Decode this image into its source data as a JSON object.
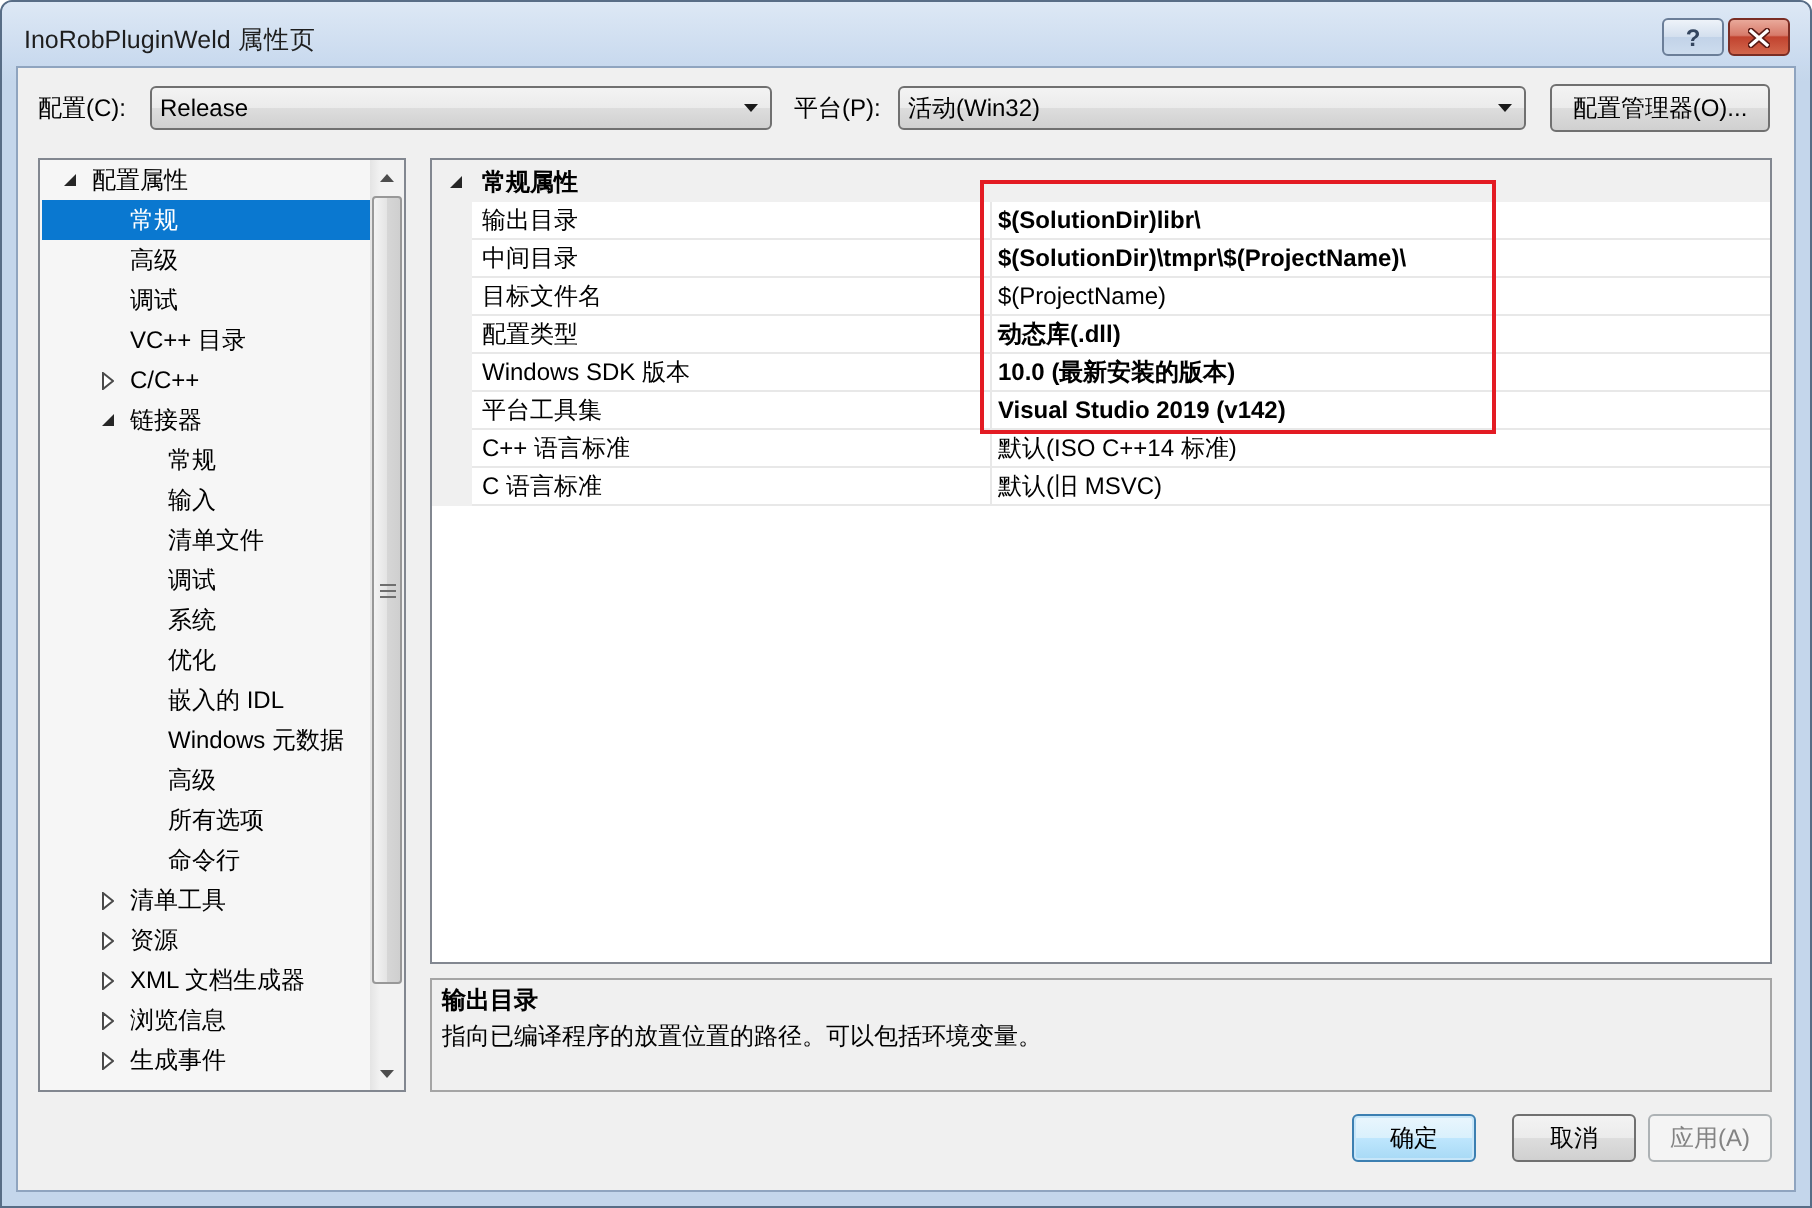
{
  "window": {
    "title": "InoRobPluginWeld 属性页",
    "help_button": "?"
  },
  "toolbar": {
    "configuration": {
      "label": "配置(C):",
      "value": "Release"
    },
    "platform": {
      "label": "平台(P):",
      "value": "活动(Win32)"
    },
    "manager_button": "配置管理器(O)..."
  },
  "tree": {
    "items": [
      {
        "label": "配置属性",
        "expanded": true,
        "selected": false,
        "children": [
          {
            "label": "常规",
            "selected": true
          },
          {
            "label": "高级",
            "selected": false
          },
          {
            "label": "调试",
            "selected": false
          },
          {
            "label": "VC++ 目录",
            "selected": false
          },
          {
            "label": "C/C++",
            "expanded": false,
            "selected": false
          },
          {
            "label": "链接器",
            "expanded": true,
            "selected": false,
            "children": [
              {
                "label": "常规",
                "selected": false
              },
              {
                "label": "输入",
                "selected": false
              },
              {
                "label": "清单文件",
                "selected": false
              },
              {
                "label": "调试",
                "selected": false
              },
              {
                "label": "系统",
                "selected": false
              },
              {
                "label": "优化",
                "selected": false
              },
              {
                "label": "嵌入的 IDL",
                "selected": false
              },
              {
                "label": "Windows 元数据",
                "selected": false
              },
              {
                "label": "高级",
                "selected": false
              },
              {
                "label": "所有选项",
                "selected": false
              },
              {
                "label": "命令行",
                "selected": false
              }
            ]
          },
          {
            "label": "清单工具",
            "expanded": false,
            "selected": false
          },
          {
            "label": "资源",
            "expanded": false,
            "selected": false
          },
          {
            "label": "XML 文档生成器",
            "expanded": false,
            "selected": false
          },
          {
            "label": "浏览信息",
            "expanded": false,
            "selected": false
          },
          {
            "label": "生成事件",
            "expanded": false,
            "selected": false
          }
        ]
      }
    ]
  },
  "property_grid": {
    "category": {
      "label": "常规属性",
      "expanded": true
    },
    "rows": [
      {
        "name": "输出目录",
        "value": "$(SolutionDir)libr\\",
        "inherited": false
      },
      {
        "name": "中间目录",
        "value": "$(SolutionDir)\\tmpr\\$(ProjectName)\\",
        "inherited": false
      },
      {
        "name": "目标文件名",
        "value": "$(ProjectName)",
        "inherited": true
      },
      {
        "name": "配置类型",
        "value": "动态库(.dll)",
        "inherited": false
      },
      {
        "name": "Windows SDK 版本",
        "value": "10.0 (最新安装的版本)",
        "inherited": false
      },
      {
        "name": "平台工具集",
        "value": "Visual Studio 2019 (v142)",
        "inherited": false
      },
      {
        "name": "C++ 语言标准",
        "value": "默认(ISO C++14 标准)",
        "inherited": true
      },
      {
        "name": "C 语言标准",
        "value": "默认(旧 MSVC)",
        "inherited": true
      }
    ],
    "annotation": {
      "kind": "frame"
    }
  },
  "description": {
    "title": "输出目录",
    "text": "指向已编译程序的放置位置的路径。可以包括环境变量。"
  },
  "buttons": [
    {
      "label": "确定",
      "default": true,
      "disabled": false
    },
    {
      "label": "取消",
      "default": false,
      "disabled": false
    },
    {
      "label": "应用(A)",
      "default": false,
      "disabled": true
    }
  ]
}
